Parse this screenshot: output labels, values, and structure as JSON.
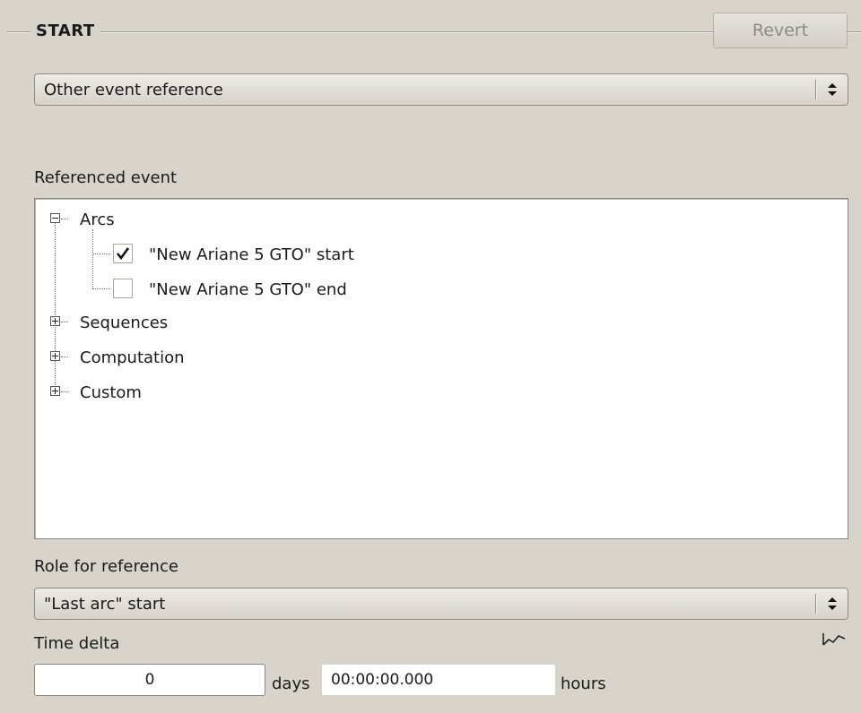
{
  "section": {
    "title": "START",
    "revert_label": "Revert"
  },
  "start_reference": {
    "selected": "Other event reference"
  },
  "referenced_event": {
    "label": "Referenced event",
    "tree": [
      {
        "label": "Arcs",
        "expanded": true,
        "children": [
          {
            "label": "\"New Ariane 5 GTO\" start",
            "checked": true
          },
          {
            "label": "\"New Ariane 5 GTO\" end",
            "checked": false
          }
        ]
      },
      {
        "label": "Sequences",
        "expanded": false
      },
      {
        "label": "Computation",
        "expanded": false
      },
      {
        "label": "Custom",
        "expanded": false
      }
    ]
  },
  "role": {
    "label": "Role for reference",
    "selected": "\"Last arc\" start"
  },
  "time_delta": {
    "label": "Time delta",
    "days_value": "0",
    "days_unit": "days",
    "hours_value": "00:00:00.000",
    "hours_unit": "hours"
  },
  "icons": {
    "combo_arrows": "up-down-arrows-icon",
    "expander_minus": "minus-expander-icon",
    "expander_plus": "plus-expander-icon",
    "checkmark": "checkmark-icon",
    "graph": "graph-icon"
  }
}
